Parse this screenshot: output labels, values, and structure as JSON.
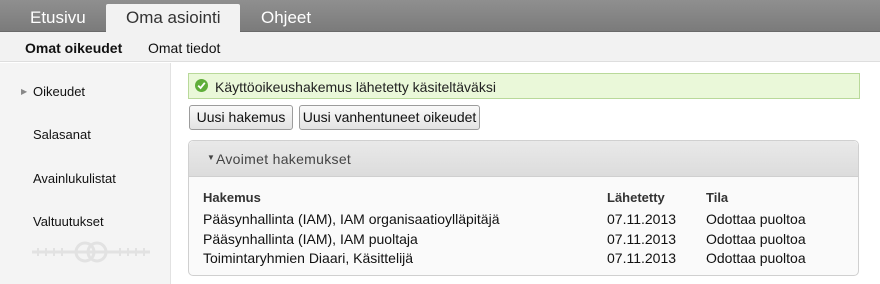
{
  "topnav": {
    "tabs": [
      {
        "label": "Etusivu"
      },
      {
        "label": "Oma asiointi"
      },
      {
        "label": "Ohjeet"
      }
    ]
  },
  "subnav": {
    "items": [
      {
        "label": "Omat oikeudet"
      },
      {
        "label": "Omat tiedot"
      }
    ]
  },
  "sidebar": {
    "items": [
      {
        "label": "Oikeudet"
      },
      {
        "label": "Salasanat"
      },
      {
        "label": "Avainlukulistat"
      },
      {
        "label": "Valtuutukset"
      }
    ]
  },
  "alert": {
    "message": "Käyttöoikeushakemus lähetetty käsiteltäväksi",
    "icon": "check-circle-icon",
    "color": "#5fae3a"
  },
  "buttons": {
    "new_application": "Uusi hakemus",
    "renew_expired": "Uusi vanhentuneet oikeudet"
  },
  "panel": {
    "title": "Avoimet hakemukset",
    "columns": [
      "Hakemus",
      "Lähetetty",
      "Tila"
    ],
    "rows": [
      {
        "hakemus": "Pääsynhallinta (IAM), IAM organisaatioylläpitäjä",
        "lahetetty": "07.11.2013",
        "tila": "Odottaa puoltoa"
      },
      {
        "hakemus": "Pääsynhallinta (IAM), IAM puoltaja",
        "lahetetty": "07.11.2013",
        "tila": "Odottaa puoltoa"
      },
      {
        "hakemus": "Toimintaryhmien Diaari, Käsittelijä",
        "lahetetty": "07.11.2013",
        "tila": "Odottaa puoltoa"
      }
    ]
  }
}
